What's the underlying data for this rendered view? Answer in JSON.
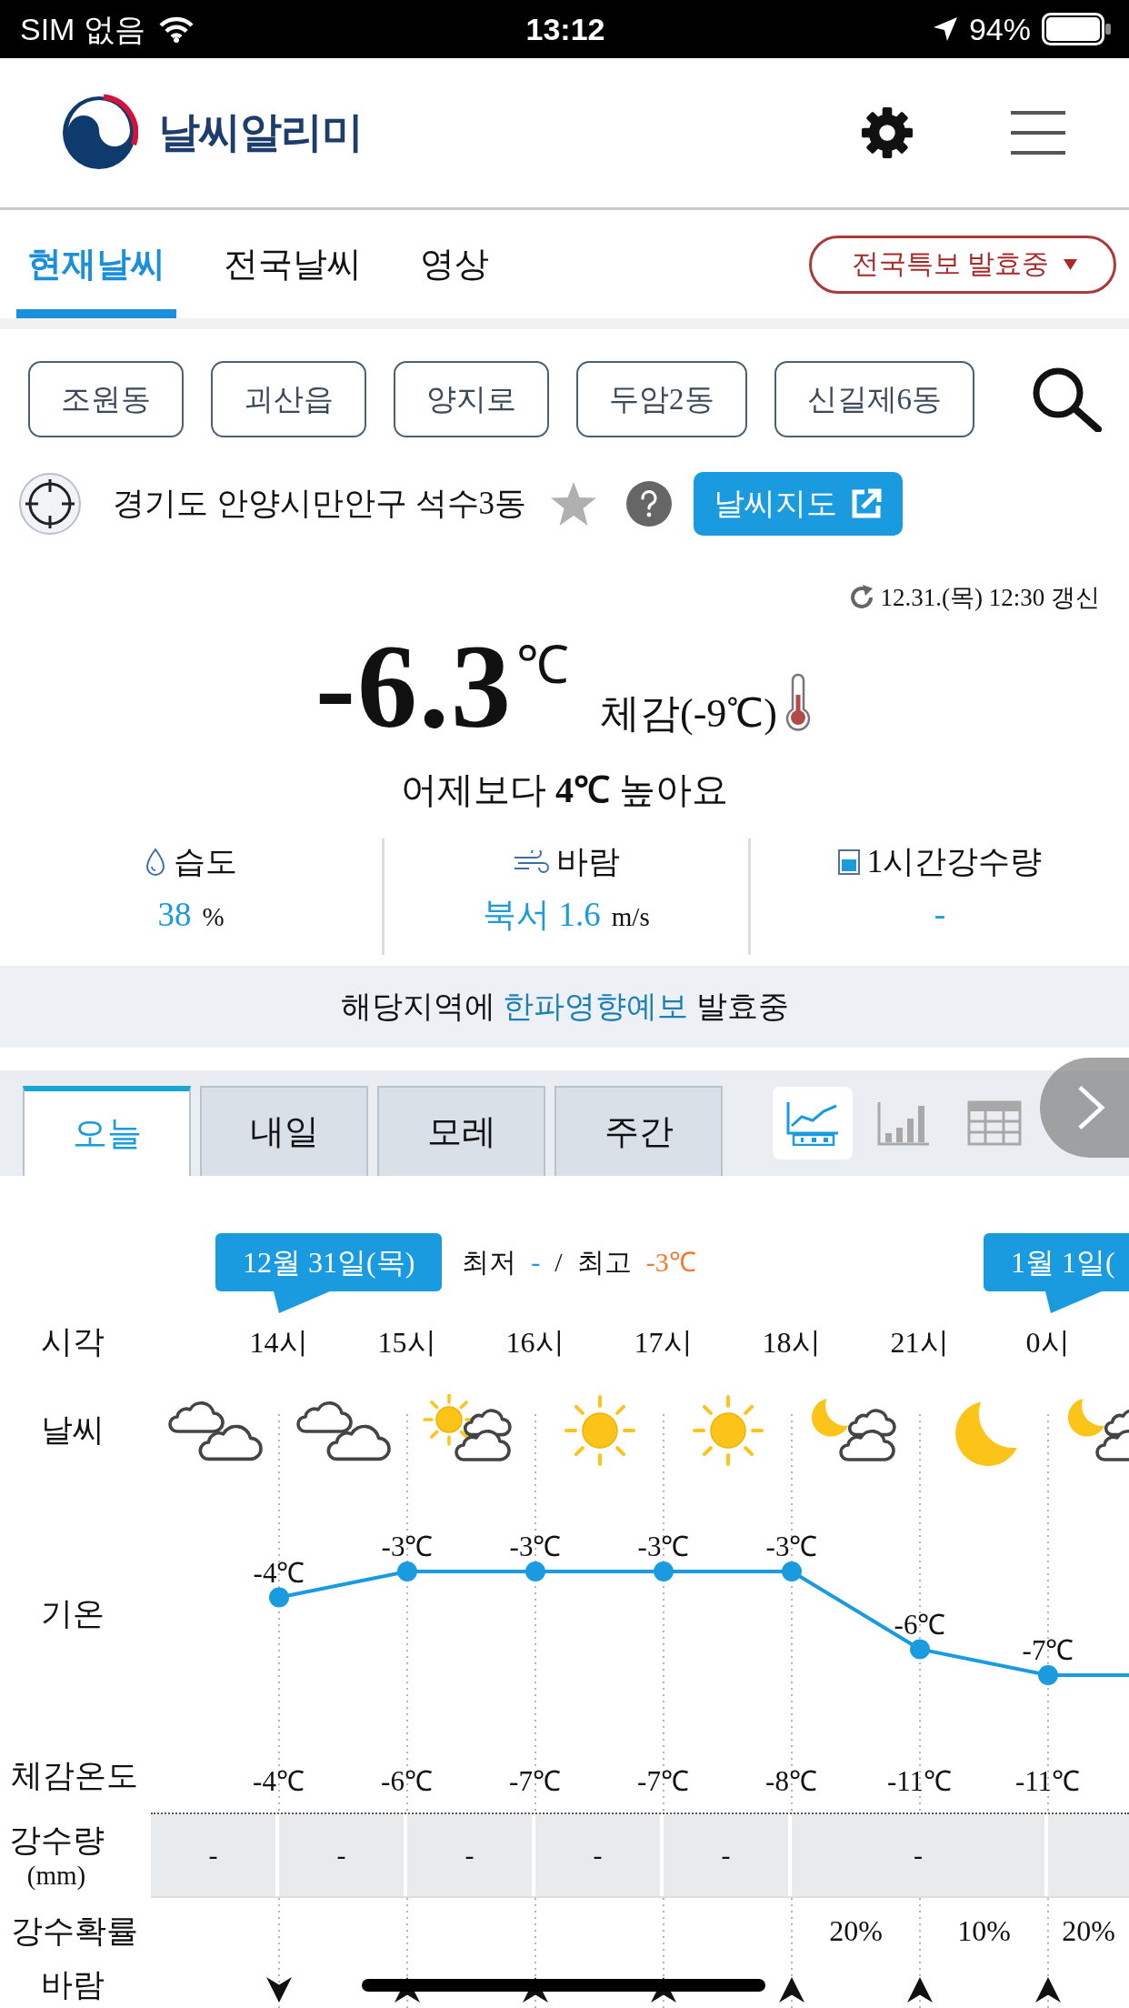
{
  "status_bar": {
    "carrier": "SIM 없음",
    "time": "13:12",
    "battery": "94%"
  },
  "header": {
    "app_name": "날씨알리미"
  },
  "tabs": [
    {
      "label": "현재날씨",
      "selected": true
    },
    {
      "label": "전국날씨",
      "selected": false
    },
    {
      "label": "영상",
      "selected": false
    }
  ],
  "alert_button": {
    "label": "전국특보 발효중"
  },
  "recent_places": [
    "조원동",
    "괴산읍",
    "양지로",
    "두암2동",
    "신길제6동"
  ],
  "location": {
    "address": "경기도 안양시만안구 석수3동",
    "favorite": false,
    "map_button": "날씨지도"
  },
  "current": {
    "updated": "12.31.(목) 12:30 갱신",
    "temperature": "-6.3",
    "unit": "℃",
    "feels_like": "체감(-9℃)",
    "comparison": "어제보다 **4℃** 높아요"
  },
  "stats": [
    {
      "kind": "humidity",
      "label": "습도",
      "value": "38",
      "unit": "%"
    },
    {
      "kind": "wind",
      "label": "바람",
      "value": "북서 1.6",
      "unit": "m/s"
    },
    {
      "kind": "rain",
      "label": "1시간강수량",
      "value": "-"
    }
  ],
  "banner": {
    "before": "해당지역에",
    "link": "한파영향예보",
    "after": "발효중"
  },
  "day_tabs": [
    {
      "label": "오늘",
      "selected": true
    },
    {
      "label": "내일",
      "selected": false
    },
    {
      "label": "모레",
      "selected": false
    },
    {
      "label": "주간",
      "selected": false
    }
  ],
  "view_modes": [
    {
      "kind": "graph",
      "selected": true
    },
    {
      "kind": "bar",
      "selected": false
    },
    {
      "kind": "table",
      "selected": false
    }
  ],
  "forecast": {
    "date_badges": [
      "12월 31일(목)",
      "1월 1일("
    ],
    "min_label": "최저",
    "min_value": "-",
    "separator": "/",
    "max_label": "최고",
    "max_value": "-3℃",
    "hours_label": "시각",
    "weather_label": "날씨",
    "weather": [
      {
        "kind": "cloudy"
      },
      {
        "kind": "cloudy"
      },
      {
        "kind": "partly_sunny"
      },
      {
        "kind": "sunny"
      },
      {
        "kind": "sunny"
      },
      {
        "kind": "partly_moon"
      },
      {
        "kind": "moon"
      },
      {
        "kind": "partly_moon"
      }
    ],
    "chart_data": {
      "type": "line",
      "categories": [
        "14시",
        "15시",
        "16시",
        "17시",
        "18시",
        "21시",
        "0시"
      ],
      "series": [
        {
          "name": "기온",
          "color": "#1a9be0",
          "marker": "o",
          "values": [
            -4,
            -3,
            -3,
            -3,
            -3,
            -6,
            -7
          ],
          "value_labels": [
            "-4℃",
            "-3℃",
            "-3℃",
            "-3℃",
            "-3℃",
            "-6℃",
            "-7℃"
          ]
        }
      ]
    },
    "feels_label": "체감온도",
    "feels": [
      "-4℃",
      "-6℃",
      "-7℃",
      "-7℃",
      "-8℃",
      "-11℃",
      "-11℃"
    ],
    "rain_label": "강수량",
    "rain_unit": "(mm)",
    "rain": [
      {
        "kind": "hourly",
        "text": "-"
      },
      {
        "kind": "hourly",
        "text": "-"
      },
      {
        "kind": "hourly",
        "text": "-"
      },
      {
        "kind": "hourly",
        "text": "-"
      },
      {
        "kind": "hourly",
        "text": "-"
      },
      {
        "kind": "merged",
        "text": "-"
      },
      {
        "kind": "hourly"
      }
    ],
    "rain_chance_label": "강수확률",
    "rain_chance": [
      {
        "kind": "blank"
      },
      {
        "kind": "blank"
      },
      {
        "kind": "blank"
      },
      {
        "kind": "blank"
      },
      {
        "kind": "blank"
      },
      {
        "kind": "value",
        "text": "20%"
      },
      {
        "kind": "value",
        "text": "10%"
      },
      {
        "kind": "value",
        "text": "20%"
      }
    ],
    "wind_label": "바람",
    "wind": [
      {
        "kind": "down"
      },
      {
        "kind": "up"
      },
      {
        "kind": "up"
      },
      {
        "kind": "up"
      },
      {
        "kind": "up"
      },
      {
        "kind": "up"
      },
      {
        "kind": "up"
      }
    ]
  }
}
